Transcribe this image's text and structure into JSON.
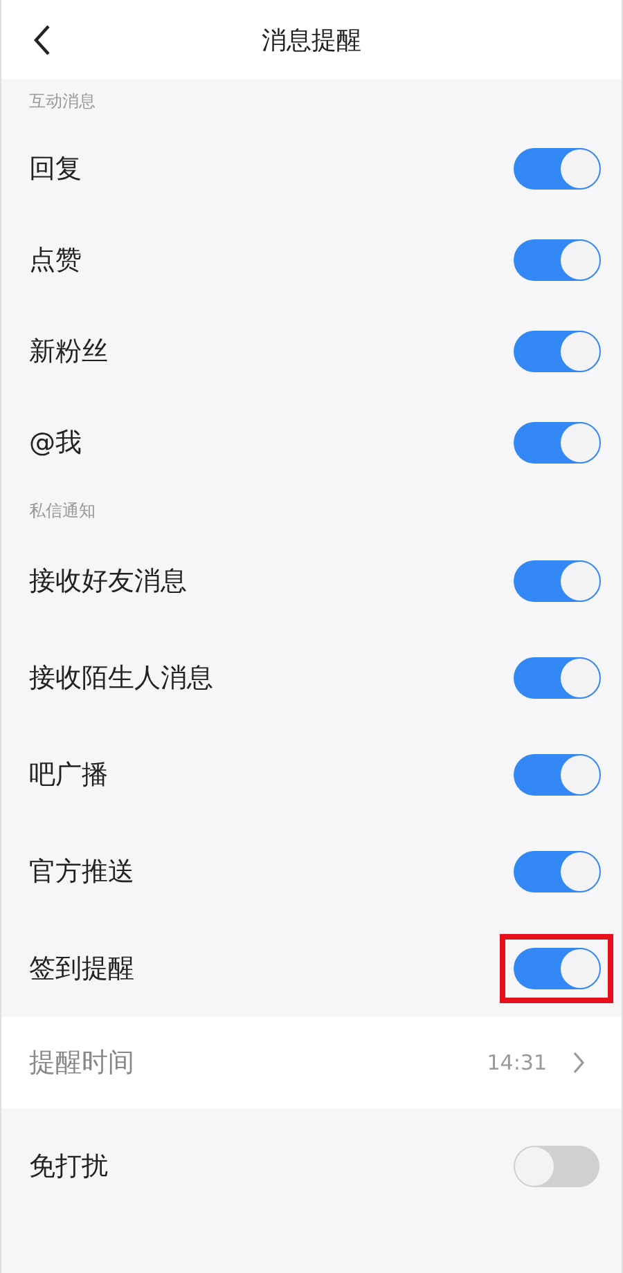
{
  "header": {
    "title": "消息提醒"
  },
  "sections": [
    {
      "title": "互动消息",
      "items": [
        {
          "kind": "toggle",
          "label": "回复",
          "on": true,
          "highlighted": false
        },
        {
          "kind": "toggle",
          "label": "点赞",
          "on": true,
          "highlighted": false
        },
        {
          "kind": "toggle",
          "label": "新粉丝",
          "on": true,
          "highlighted": false
        },
        {
          "kind": "toggle",
          "label": "@我",
          "on": true,
          "highlighted": false
        }
      ]
    },
    {
      "title": "私信通知",
      "items": [
        {
          "kind": "toggle",
          "label": "接收好友消息",
          "on": true,
          "highlighted": false
        },
        {
          "kind": "toggle",
          "label": "接收陌生人消息",
          "on": true,
          "highlighted": false
        },
        {
          "kind": "toggle",
          "label": "吧广播",
          "on": true,
          "highlighted": false
        },
        {
          "kind": "toggle",
          "label": "官方推送",
          "on": true,
          "highlighted": false
        },
        {
          "kind": "toggle",
          "label": "签到提醒",
          "on": true,
          "highlighted": true
        },
        {
          "kind": "link",
          "label": "提醒时间",
          "value": "14:31"
        },
        {
          "kind": "toggle",
          "label": "免打扰",
          "on": false,
          "highlighted": false
        }
      ]
    }
  ]
}
